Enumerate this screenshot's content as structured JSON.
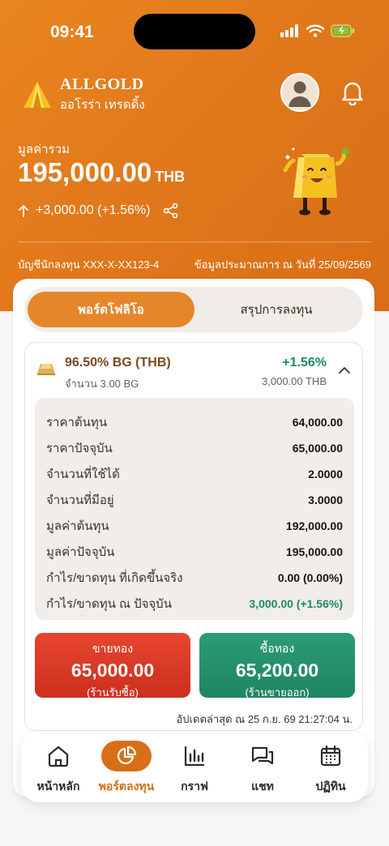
{
  "status_bar": {
    "time": "09:41"
  },
  "brand": {
    "name": "ALLGOLD",
    "subtitle": "ออโรร่า เทรดดิ้ง"
  },
  "summary": {
    "label": "มูลค่ารวม",
    "value": "195,000.00",
    "currency": "THB",
    "change": "+3,000.00 (+1.56%)"
  },
  "account": {
    "account_text": "บัญชีนักลงทุน XXX-X-XX123-4",
    "date_text": "ข้อมูลประมาณการ ณ วันที่  25/09/2569"
  },
  "tabs": [
    {
      "label": "พอร์ตโฟลิโอ",
      "active": true
    },
    {
      "label": "สรุปการลงทุน",
      "active": false
    }
  ],
  "holding": {
    "title": "96.50% BG (THB)",
    "quantity": "จำนวน 3.00 BG",
    "change_pct": "+1.56%",
    "value": "3,000.00 THB",
    "details": [
      {
        "label": "ราคาต้นทุน",
        "value": "64,000.00"
      },
      {
        "label": "ราคาปัจจุบัน",
        "value": "65,000.00"
      },
      {
        "label": "จำนวนที่ใช้ได้",
        "value": "2.0000"
      },
      {
        "label": "จำนวนที่มีอยู่",
        "value": "3.0000"
      },
      {
        "label": "มูลค่าต้นทุน",
        "value": "192,000.00"
      },
      {
        "label": "มูลค่าปัจจุบัน",
        "value": "195,000.00"
      },
      {
        "label": "กำไร/ขาดทุน ที่เกิดขึ้นจริง",
        "value": "0.00 (0.00%)"
      },
      {
        "label": "กำไร/ขาดทุน ณ ปัจจุบัน",
        "value": "3,000.00 (+1.56%)"
      }
    ],
    "sell": {
      "label": "ขายทอง",
      "price": "65,000.00",
      "note": "(ร้านรับซื้อ)"
    },
    "buy": {
      "label": "ซื้อทอง",
      "price": "65,200.00",
      "note": "(ร้านขายออก)"
    },
    "updated": "อัปเดตล่าสุด ณ 25 ก.ย. 69 21:27:04 น."
  },
  "nav": [
    {
      "label": "หน้าหลัก",
      "icon": "home-icon"
    },
    {
      "label": "พอร์ตลงทุน",
      "icon": "pie-chart-icon",
      "active": true
    },
    {
      "label": "กราฟ",
      "icon": "bar-chart-icon"
    },
    {
      "label": "แชท",
      "icon": "chat-icon"
    },
    {
      "label": "ปฏิทิน",
      "icon": "calendar-icon"
    }
  ],
  "colors": {
    "brand_orange": "#e6862b",
    "positive_green": "#1f8a60",
    "sell_red": "#d9381f",
    "buy_green": "#25906d"
  }
}
